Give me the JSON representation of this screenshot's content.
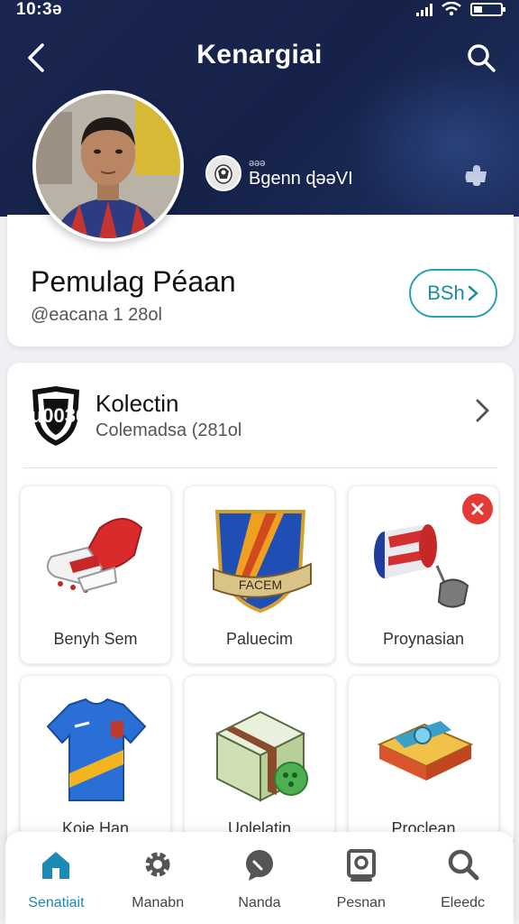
{
  "status_bar": {
    "time": "10:3ə"
  },
  "header": {
    "title": "Kenargiai"
  },
  "club": {
    "small_text": "əəə",
    "name": "Bgenn ɖəəVI"
  },
  "profile": {
    "name": "Pemulag Péaan",
    "handle": "@eacana 1 28ol",
    "button_label": "BSh"
  },
  "collection": {
    "title": "Kolectin",
    "subtitle": "Colemadsa (281ol",
    "items": [
      {
        "label": "Benyh Sem",
        "icon": "boots-icon"
      },
      {
        "label": "Paluecim",
        "icon": "crest-icon"
      },
      {
        "label": "Proynasian",
        "icon": "scarf-icon"
      },
      {
        "label": "Koie Han",
        "icon": "jersey-icon"
      },
      {
        "label": "Uolelatin",
        "icon": "box-icon"
      },
      {
        "label": "Proclean",
        "icon": "pack-icon"
      }
    ]
  },
  "nav": [
    {
      "label": "Senatiait",
      "icon": "home-icon",
      "active": true
    },
    {
      "label": "Manabn",
      "icon": "gear-icon",
      "active": false
    },
    {
      "label": "Nanda",
      "icon": "chat-icon",
      "active": false
    },
    {
      "label": "Pesnan",
      "icon": "scan-icon",
      "active": false
    },
    {
      "label": "Eleedc",
      "icon": "search-icon",
      "active": false
    }
  ],
  "colors": {
    "header_bg": "#1b2650",
    "accent": "#2aa3b0",
    "nav_active": "#1b8ab5",
    "remove_badge": "#e53935"
  }
}
